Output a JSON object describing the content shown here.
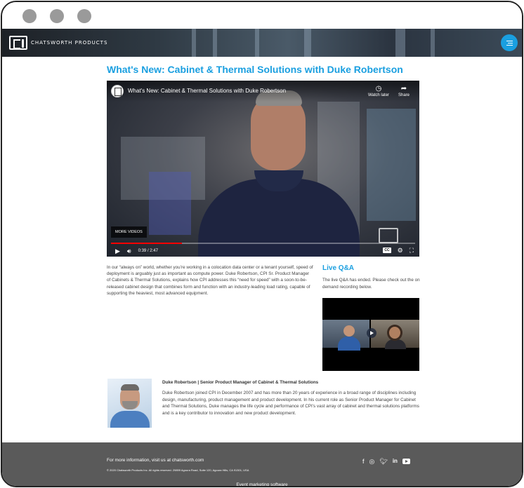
{
  "header": {
    "logo_text": "CHATSWORTH PRODUCTS",
    "menu_icon": "menu-icon",
    "accent": "#1a9fe0"
  },
  "page": {
    "title": "What's New: Cabinet & Thermal Solutions with Duke Robertson"
  },
  "video": {
    "title": "What's New: Cabinet & Thermal Solutions with Duke Robertson",
    "watch_later": "Watch later",
    "share": "Share",
    "more_videos": "MORE VIDEOS",
    "time": "0:39 / 2:47",
    "cc": "CC",
    "progress_fraction": 0.233
  },
  "intro": {
    "text": "In our “always on” world, whether you’re working in a colocation data center or a tenant yourself, speed of deployment is arguably just as important as compute power. Duke Robertson, CPI Sr. Product Manager of Cabinets & Thermal Solutions, explains how CPI addresses this “need for speed” with a soon-to-be-released cabinet design that combines form and function with an industry-leading load rating, capable of supporting the heaviest, most advanced equipment."
  },
  "qa": {
    "title": "Live Q&A",
    "text": "The live Q&A has ended. Please check out the on demand recording below."
  },
  "bio": {
    "name": "Duke Robertson | Senior Product Manager of Cabinet & Thermal Solutions",
    "text": "Duke Robertson joined CPI in December 2007 and has more than 20 years of experience in a broad range of disciplines including design, manufacturing, product management and product development. In his current role as Senior Product Manager for Cabinet and Thermal Solutions, Duke manages the life cycle and performance of CPI’s vast array of cabinet and thermal solutions platforms and is a key contributor to innovation and new product development."
  },
  "footer": {
    "more_info": "For more information, visit us at chatsworth.com",
    "copyright": "© 2020 Chatsworth Products Inc. All rights reserved. 29899 Agoura Road, Suite 120, Agoura Hills, CA 91301, USA",
    "event_text": "Event marketing software",
    "background": "#5a5a5a"
  }
}
